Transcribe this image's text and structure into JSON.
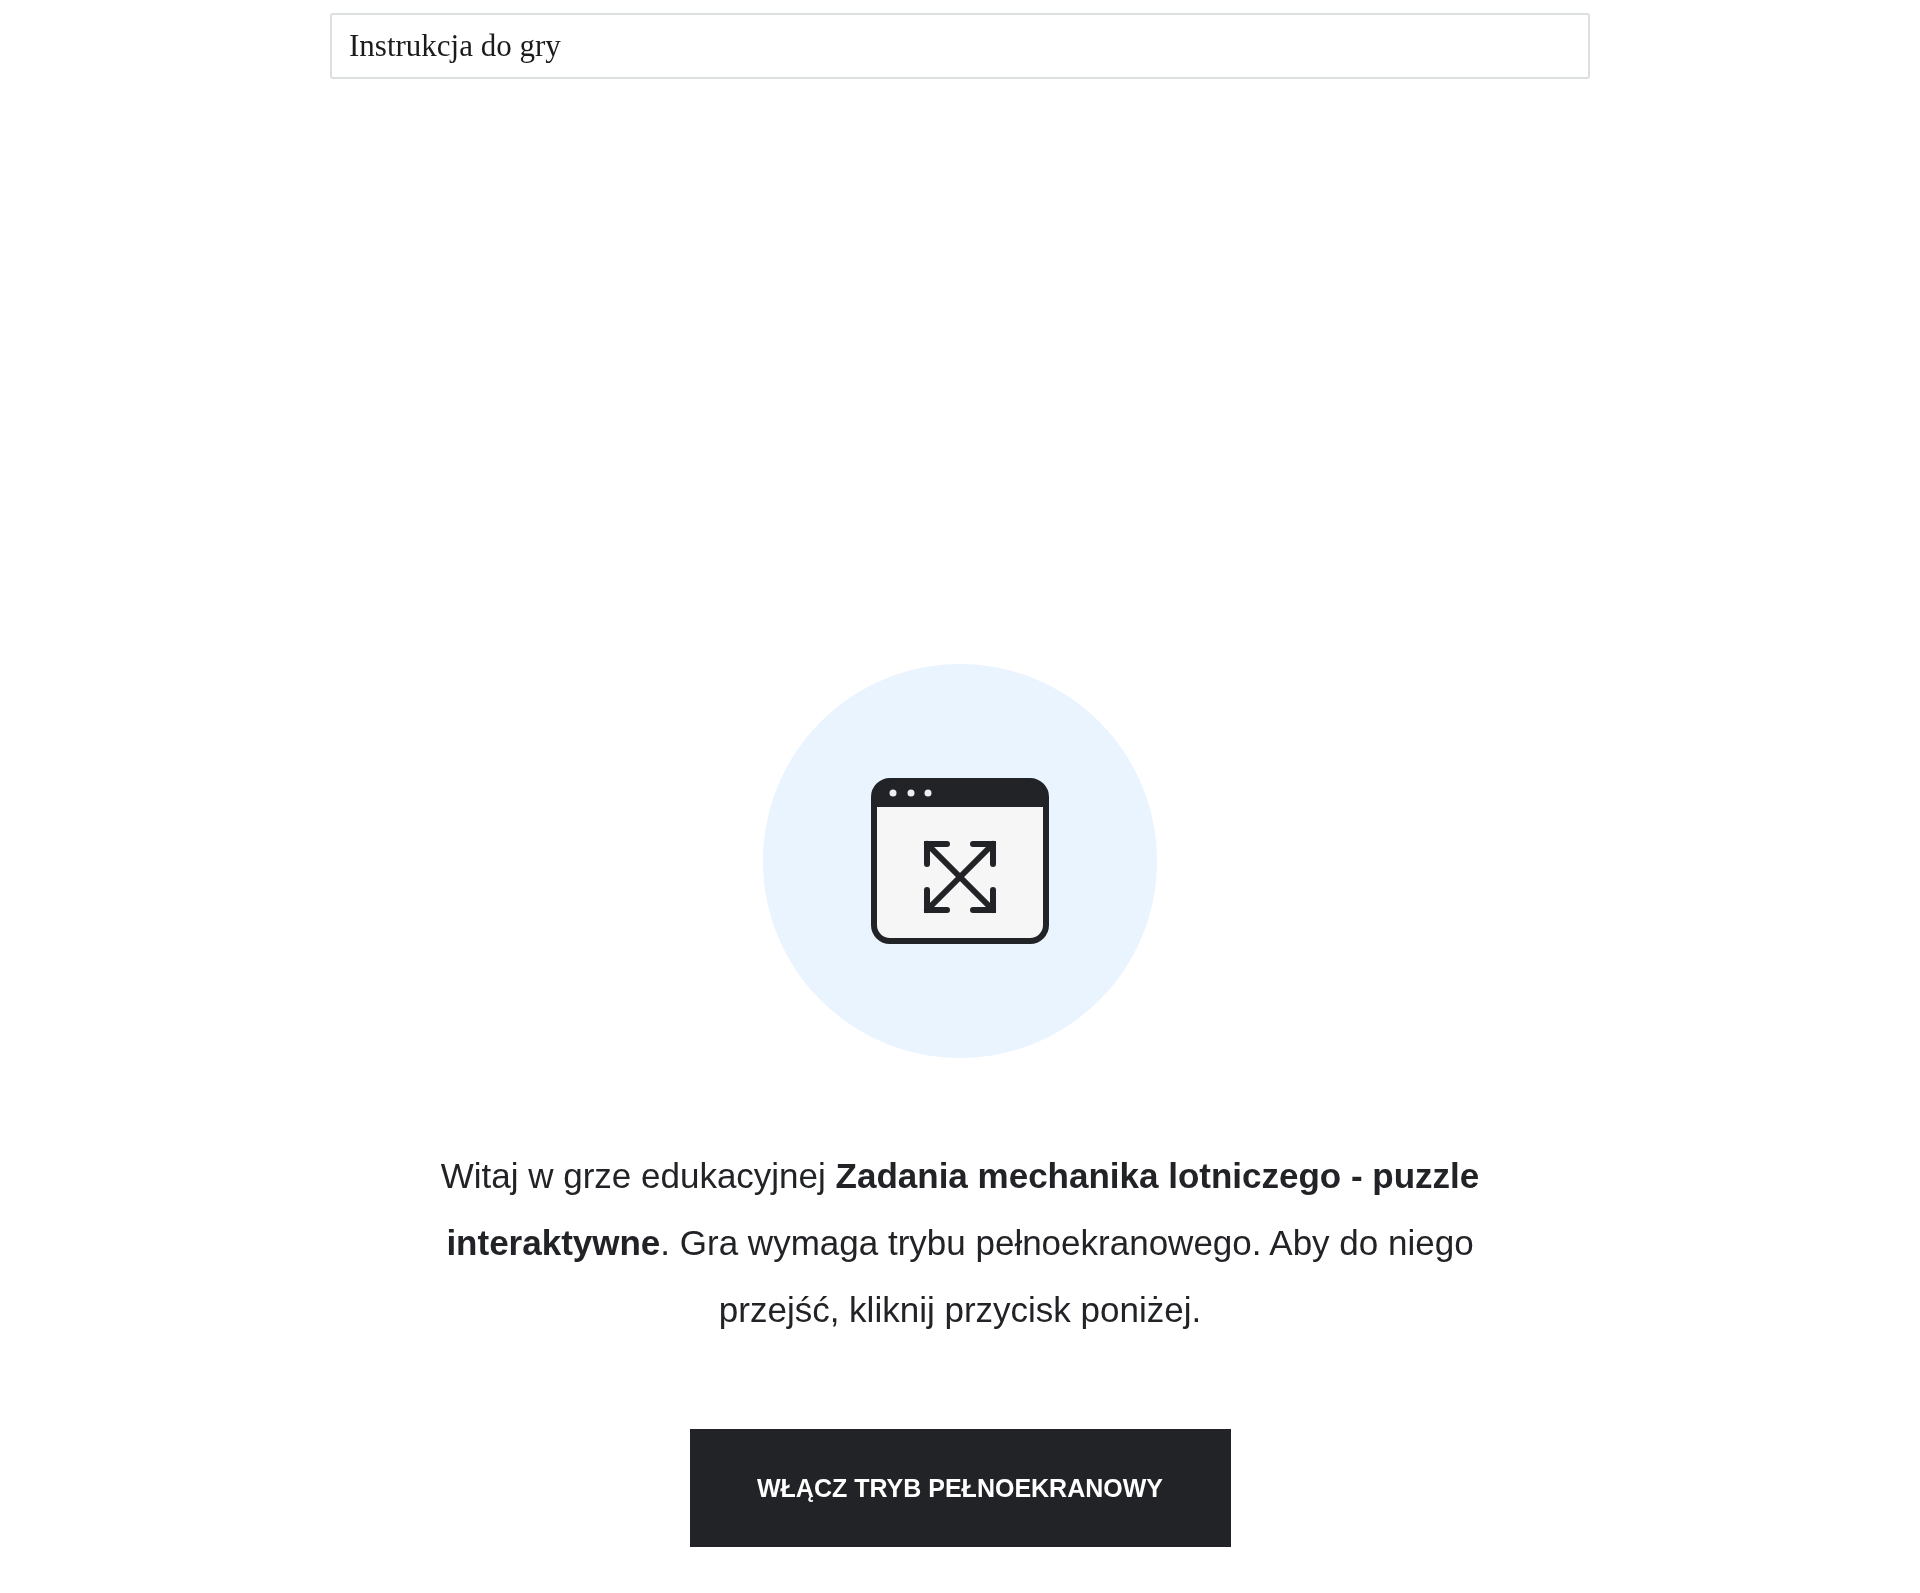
{
  "instructions_bar": {
    "title": "Instrukcja do gry"
  },
  "message": "Witaj w grze edukacyjnej **Zadania mechanika lotniczego - puzzle interaktywne**. Gra wymaga trybu pełnoekranowego. Aby do niego przejść, kliknij przycisk poniżej.",
  "button": {
    "label": "WŁĄCZ TRYB PEŁNOEKRANOWY"
  }
}
